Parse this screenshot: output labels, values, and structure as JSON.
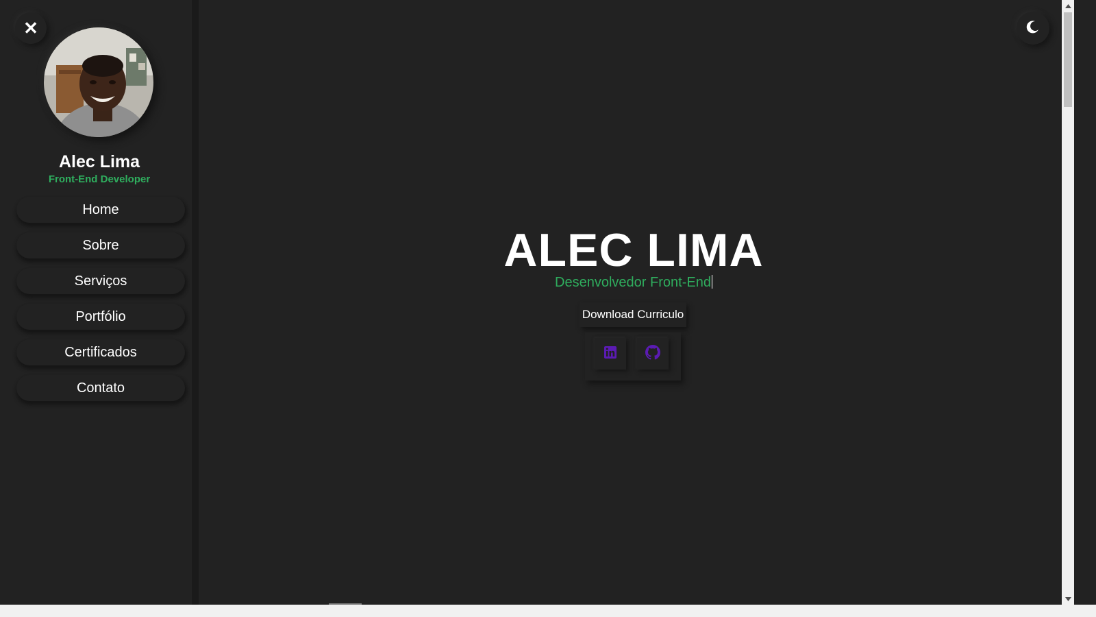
{
  "sidebar": {
    "close_label": "✕",
    "profile": {
      "name": "Alec Lima",
      "role": "Front-End Developer"
    },
    "nav_items": [
      {
        "label": "Home"
      },
      {
        "label": "Sobre"
      },
      {
        "label": "Serviços"
      },
      {
        "label": "Portfólio"
      },
      {
        "label": "Certificados"
      },
      {
        "label": "Contato"
      }
    ]
  },
  "header": {
    "theme_icon": "moon-icon"
  },
  "hero": {
    "title": "ALEC LIMA",
    "subtitle": "Desenvolvedor Front-End",
    "download_label": "Download Curriculo",
    "social_icons": [
      "linkedin-icon",
      "github-icon"
    ]
  },
  "colors": {
    "background": "#222222",
    "accent_green": "#2fae5e",
    "social_icon_purple": "#5b1bb3"
  }
}
